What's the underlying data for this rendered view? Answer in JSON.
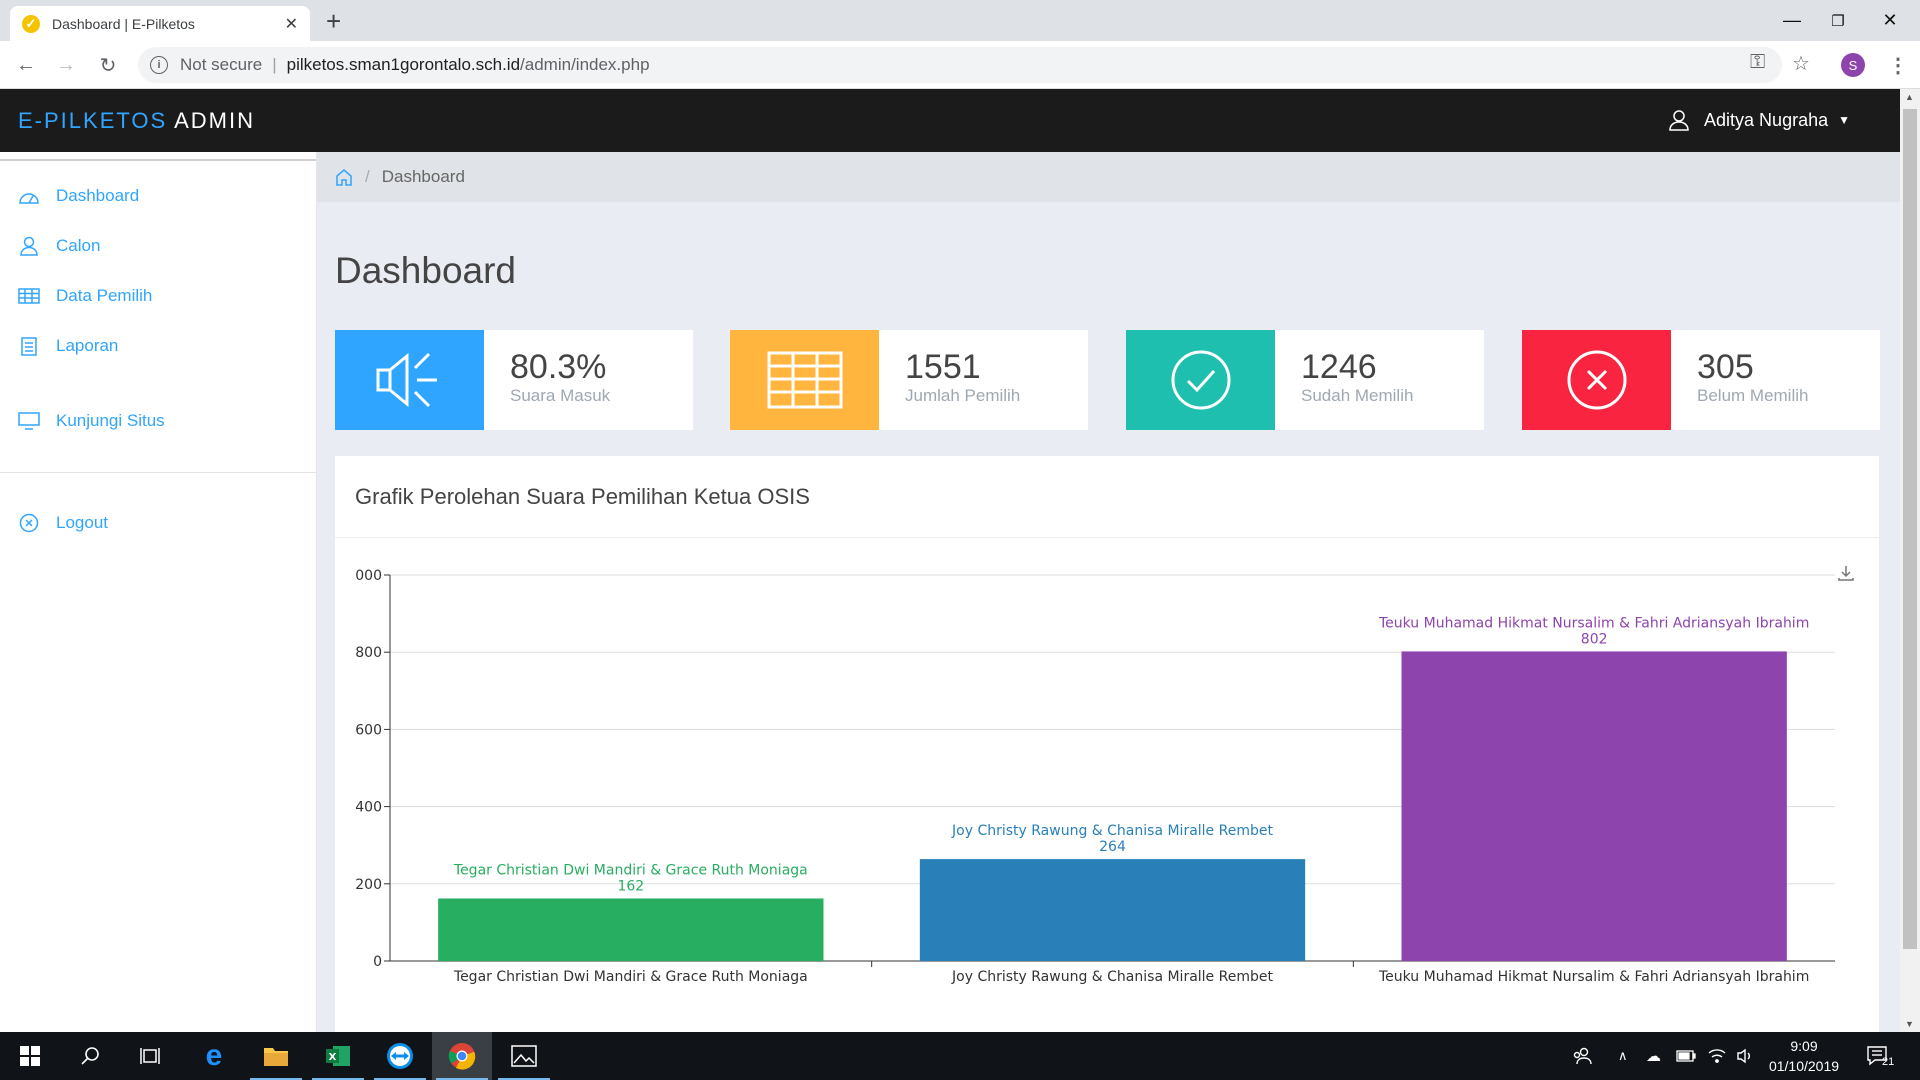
{
  "browser": {
    "tab_title": "Dashboard | E-Pilketos",
    "not_secure": "Not secure",
    "url_host": "pilketos.sman1gorontalo.sch.id",
    "url_path": "/admin/index.php",
    "profile_initial": "S"
  },
  "header": {
    "brand_primary": "E-PILKETOS",
    "brand_secondary": "ADMIN",
    "user_name": "Aditya Nugraha"
  },
  "sidebar": {
    "items": [
      {
        "label": "Dashboard",
        "icon": "dashboard-icon"
      },
      {
        "label": "Calon",
        "icon": "user-icon"
      },
      {
        "label": "Data Pemilih",
        "icon": "table-icon"
      },
      {
        "label": "Laporan",
        "icon": "clipboard-icon"
      },
      {
        "label": "Kunjungi Situs",
        "icon": "monitor-icon"
      },
      {
        "label": "Logout",
        "icon": "close-circle-icon"
      }
    ]
  },
  "breadcrumb": {
    "current": "Dashboard"
  },
  "page_title": "Dashboard",
  "stats": [
    {
      "value": "80.3%",
      "label": "Suara Masuk",
      "color": "#30a5ff",
      "icon": "speaker-icon"
    },
    {
      "value": "1551",
      "label": "Jumlah Pemilih",
      "color": "#ffb53e",
      "icon": "table-icon"
    },
    {
      "value": "1246",
      "label": "Sudah Memilih",
      "color": "#1ebfae",
      "icon": "check-circle-icon"
    },
    {
      "value": "305",
      "label": "Belum Memilih",
      "color": "#f9243f",
      "icon": "close-circle-icon"
    }
  ],
  "panel_title": "Grafik Perolehan Suara Pemilihan Ketua OSIS",
  "chart_data": {
    "type": "bar",
    "categories": [
      "Tegar Christian Dwi Mandiri & Grace Ruth Moniaga",
      "Joy Christy Rawung & Chanisa Miralle Rembet",
      "Teuku Muhamad Hikmat Nursalim & Fahri Adriansyah Ibrahim"
    ],
    "values": [
      162,
      264,
      802
    ],
    "colors": [
      "#27ae60",
      "#2980b9",
      "#8e44ad"
    ],
    "yticks": [
      "0",
      "200",
      "400",
      "600",
      "800",
      "000"
    ],
    "ylim": [
      0,
      1000
    ],
    "grid": true
  },
  "taskbar": {
    "time": "9:09",
    "date": "01/10/2019",
    "notifications": "21"
  }
}
